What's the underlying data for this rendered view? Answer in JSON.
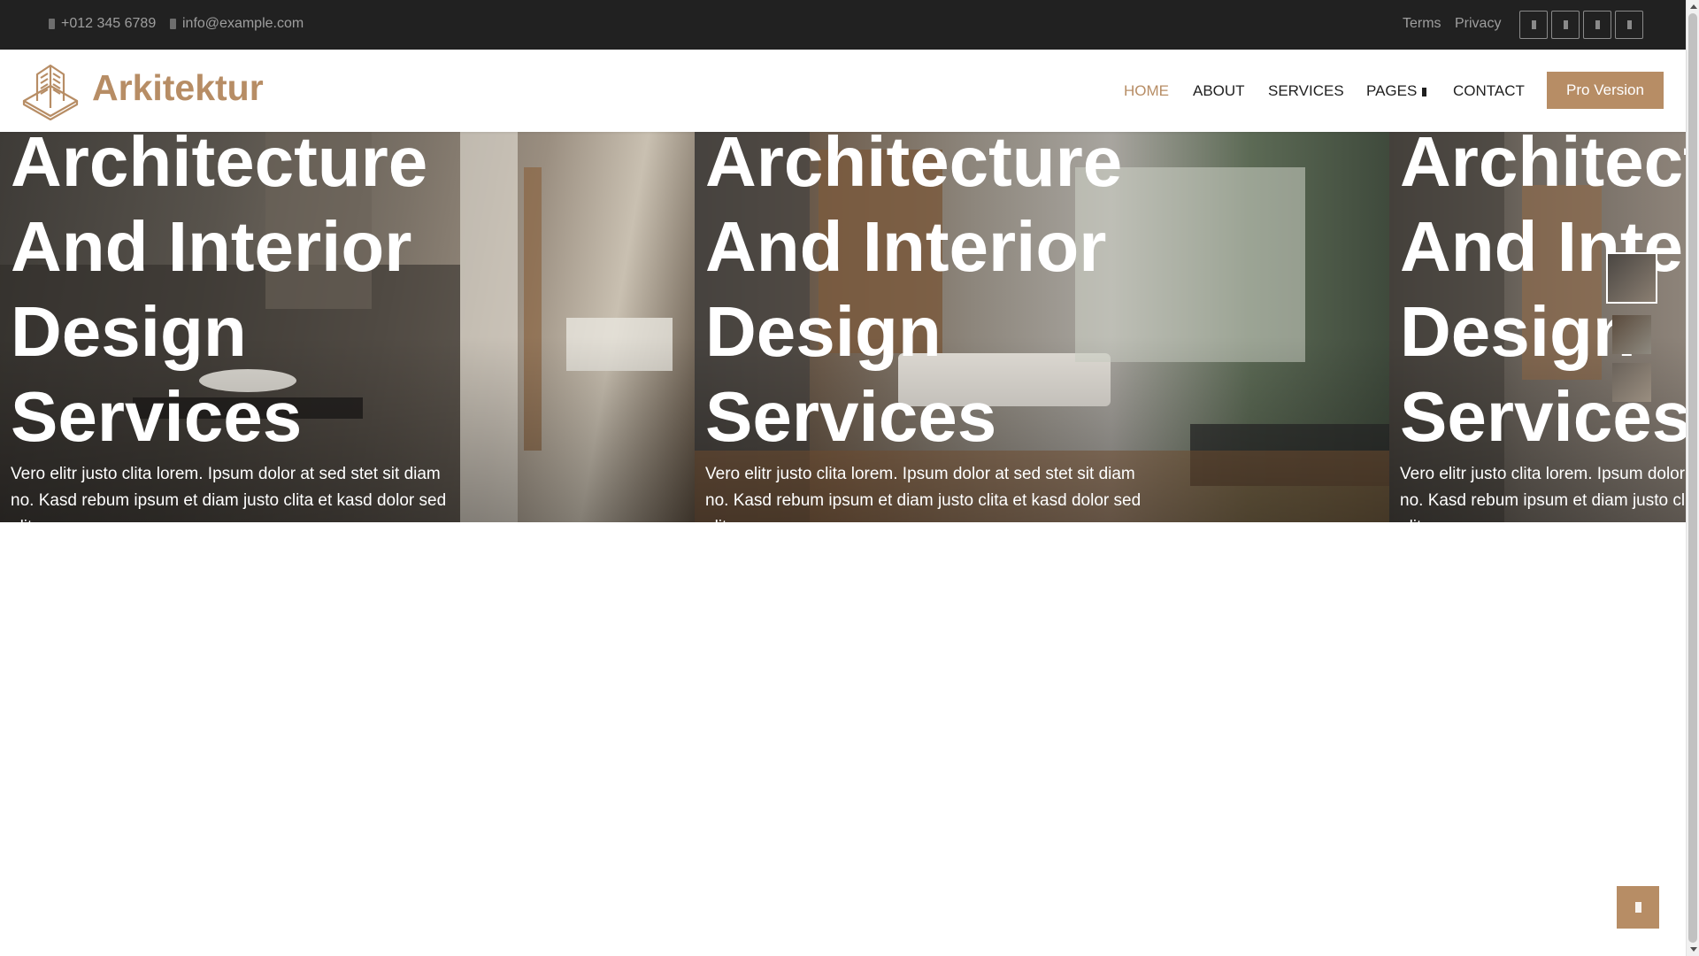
{
  "topbar": {
    "phone": "+012 345 6789",
    "email": "info@example.com",
    "links": [
      {
        "label": "Terms"
      },
      {
        "label": "Privacy"
      }
    ],
    "social_icons": [
      "facebook-icon",
      "twitter-icon",
      "linkedin-icon",
      "instagram-icon"
    ]
  },
  "navbar": {
    "brand": "Arkitektur",
    "items": [
      {
        "label": "HOME",
        "active": true
      },
      {
        "label": "ABOUT"
      },
      {
        "label": "SERVICES"
      },
      {
        "label": "PAGES",
        "dropdown": true
      },
      {
        "label": "CONTACT"
      }
    ],
    "cta": "Pro Version"
  },
  "hero": {
    "slides": [
      {
        "title": "Architecture And Interior Design Services",
        "text": "Vero elitr justo clita lorem. Ipsum dolor at sed stet sit diam no. Kasd rebum ipsum et diam justo clita et kasd dolor sed elitr."
      },
      {
        "title": "Architecture And Interior Design Services",
        "text": "Vero elitr justo clita lorem. Ipsum dolor at sed stet sit diam no. Kasd rebum ipsum et diam justo clita et kasd dolor sed elitr."
      },
      {
        "title": "Architecture And Interior Design Services",
        "text": "Vero elitr justo clita lorem. Ipsum dolor at sed stet sit diam no. Kasd rebum ipsum et diam justo clita et kasd dolor sed elitr."
      }
    ],
    "thumbnails": [
      {
        "active": true
      },
      {
        "active": false
      },
      {
        "active": false
      }
    ]
  },
  "colors": {
    "accent": "#b78d65",
    "topbar_bg": "#212121",
    "topbar_text": "#9e9e9e",
    "nav_text": "#1f1f1f"
  },
  "icons": {
    "phone": "phone-icon",
    "email": "envelope-icon",
    "dropdown": "chevron-down-icon",
    "back_to_top": "arrow-up-icon",
    "logo": "building-logo-icon"
  }
}
